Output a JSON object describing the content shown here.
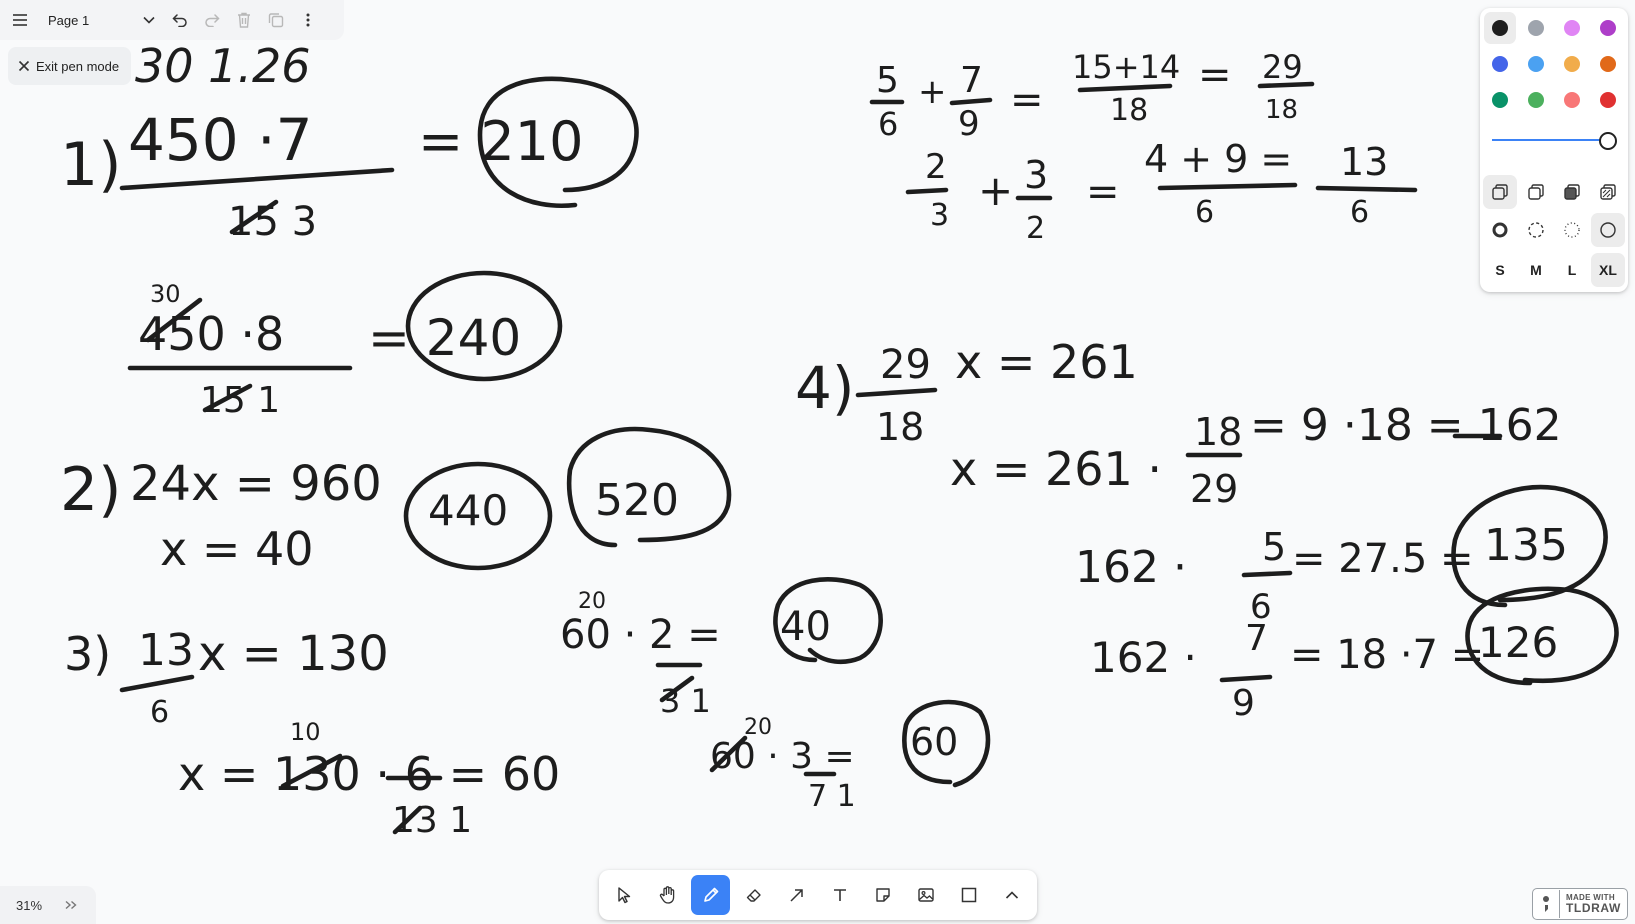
{
  "page_menu": {
    "page_name": "Page 1"
  },
  "exit_pen": {
    "label": "Exit pen mode"
  },
  "zoom": {
    "value": "31%"
  },
  "badge": {
    "line1": "MADE WITH",
    "line2": "TLDRAW"
  },
  "style_panel": {
    "colors": [
      "#1d1d1d",
      "#9ea4ad",
      "#e085f4",
      "#ae3ec9",
      "#4465e9",
      "#4ba1f1",
      "#f1ac4b",
      "#e16919",
      "#099268",
      "#4cb05e",
      "#f87777",
      "#e03131"
    ],
    "selected_color": "#1d1d1d",
    "opacity": 1.0,
    "sizes": [
      "S",
      "M",
      "L",
      "XL"
    ],
    "selected_size": "XL"
  },
  "toolbar": {
    "tools": [
      "select",
      "hand",
      "draw",
      "eraser",
      "arrow",
      "text",
      "note",
      "asset",
      "rectangle",
      "more"
    ],
    "active_tool": "draw"
  },
  "canvas": {
    "texts": [
      {
        "id": "a1",
        "t": "30 1.26"
      },
      {
        "id": "a2",
        "t": "1)"
      },
      {
        "id": "a3",
        "t": "450 ·7"
      },
      {
        "id": "a4",
        "t": "15 3"
      },
      {
        "id": "a5",
        "t": "= 210"
      },
      {
        "id": "b1",
        "t": "30"
      },
      {
        "id": "b2",
        "t": "450 ·8"
      },
      {
        "id": "b3",
        "t": "15 1"
      },
      {
        "id": "b4",
        "t": "= 240"
      },
      {
        "id": "c1",
        "t": "2)"
      },
      {
        "id": "c2",
        "t": "24x = 960"
      },
      {
        "id": "c3",
        "t": "x = 40"
      },
      {
        "id": "c4",
        "t": "440"
      },
      {
        "id": "c5",
        "t": "520"
      },
      {
        "id": "d1",
        "t": "3)"
      },
      {
        "id": "d2",
        "t": "13"
      },
      {
        "id": "d3",
        "t": "6"
      },
      {
        "id": "d4",
        "t": "x = 130"
      },
      {
        "id": "d5",
        "t": "10"
      },
      {
        "id": "d6",
        "t": "x = 130 · 6 = 60"
      },
      {
        "id": "d7",
        "t": "13 1"
      },
      {
        "id": "e1",
        "t": "20"
      },
      {
        "id": "e2",
        "t": "60 · 2 ="
      },
      {
        "id": "e3",
        "t": "3 1"
      },
      {
        "id": "e4",
        "t": "40"
      },
      {
        "id": "e5",
        "t": "20"
      },
      {
        "id": "e6",
        "t": "60 · 3 ="
      },
      {
        "id": "e7",
        "t": "7 1"
      },
      {
        "id": "e8",
        "t": "60"
      },
      {
        "id": "f1",
        "t": "5"
      },
      {
        "id": "f2",
        "t": "6"
      },
      {
        "id": "f3",
        "t": "+"
      },
      {
        "id": "f4",
        "t": "7"
      },
      {
        "id": "f5",
        "t": "9"
      },
      {
        "id": "f6",
        "t": "="
      },
      {
        "id": "f7",
        "t": "15+14"
      },
      {
        "id": "f8",
        "t": "18"
      },
      {
        "id": "f9",
        "t": "="
      },
      {
        "id": "f10",
        "t": "29"
      },
      {
        "id": "f11",
        "t": "18"
      },
      {
        "id": "g1",
        "t": "2"
      },
      {
        "id": "g2",
        "t": "3"
      },
      {
        "id": "g3",
        "t": "+"
      },
      {
        "id": "g4",
        "t": "3"
      },
      {
        "id": "g5",
        "t": "2"
      },
      {
        "id": "g6",
        "t": "="
      },
      {
        "id": "g7",
        "t": "4 + 9 ="
      },
      {
        "id": "g8",
        "t": "6"
      },
      {
        "id": "g9",
        "t": "13"
      },
      {
        "id": "g10",
        "t": "6"
      },
      {
        "id": "h1",
        "t": "4)"
      },
      {
        "id": "h2",
        "t": "29"
      },
      {
        "id": "h3",
        "t": "18"
      },
      {
        "id": "h4",
        "t": "x = 261"
      },
      {
        "id": "h5",
        "t": "x = 261 ·"
      },
      {
        "id": "h6",
        "t": "18"
      },
      {
        "id": "h7",
        "t": "29"
      },
      {
        "id": "h8",
        "t": "= 9 ·18 = 162"
      },
      {
        "id": "i1",
        "t": "162 ·"
      },
      {
        "id": "i2",
        "t": "5"
      },
      {
        "id": "i3",
        "t": "6"
      },
      {
        "id": "i4",
        "t": "= 27.5 ="
      },
      {
        "id": "i5",
        "t": "135"
      },
      {
        "id": "j1",
        "t": "162 ·"
      },
      {
        "id": "j2",
        "t": "7"
      },
      {
        "id": "j3",
        "t": "9"
      },
      {
        "id": "j4",
        "t": "= 18 ·7 ="
      },
      {
        "id": "j5",
        "t": "126"
      }
    ]
  }
}
